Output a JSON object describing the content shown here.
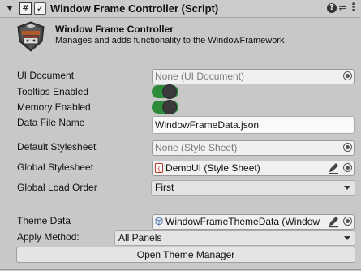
{
  "header": {
    "script_glyph": "#",
    "checkbox_glyph": "✓",
    "title": "Window Frame Controller (Script)",
    "help_glyph": "?",
    "preset_glyph": "⇌",
    "more_glyph": "⋮"
  },
  "info": {
    "title": "Window Frame Controller",
    "description": "Manages and adds functionality to the WindowFramework"
  },
  "fields": {
    "ui_document": {
      "label": "UI Document",
      "value": "None (UI Document)"
    },
    "tooltips_enabled": {
      "label": "Tooltips Enabled",
      "on": true
    },
    "memory_enabled": {
      "label": "Memory Enabled",
      "on": true
    },
    "data_file_name": {
      "label": "Data File Name",
      "value": "WindowFrameData.json"
    },
    "default_stylesheet": {
      "label": "Default Stylesheet",
      "value": "None (Style Sheet)"
    },
    "global_stylesheet": {
      "label": "Global Stylesheet",
      "value": "DemoUI (Style Sheet)"
    },
    "global_load_order": {
      "label": "Global Load Order",
      "value": "First"
    },
    "theme_data": {
      "label": "Theme Data",
      "value": "WindowFrameThemeData (Window"
    },
    "apply_method": {
      "label": "Apply Method:",
      "value": "All Panels"
    }
  },
  "buttons": {
    "open_theme_manager": "Open Theme Manager"
  },
  "colors": {
    "background": "#c8c8c8",
    "toggle_on": "#2c8c3c"
  }
}
